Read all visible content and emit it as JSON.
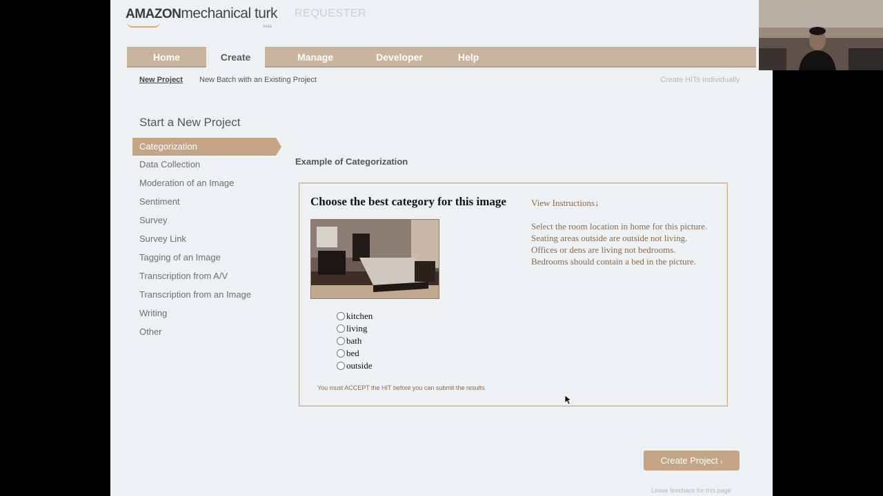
{
  "header": {
    "logo_prefix": "amazon",
    "logo_suffix": "mechanical turk",
    "logo_beta": "beta",
    "section": "REQUESTER"
  },
  "tabs": [
    {
      "label": "Home"
    },
    {
      "label": "Create"
    },
    {
      "label": "Manage"
    },
    {
      "label": "Developer"
    },
    {
      "label": "Help"
    }
  ],
  "active_tab": "Create",
  "subnav": {
    "new_project": "New Project",
    "new_batch": "New Batch with an Existing Project",
    "create_individually": "Create HITs Individually"
  },
  "sidebar": {
    "title": "Start a New Project",
    "selected": "Categorization",
    "items": [
      "Data Collection",
      "Moderation of an Image",
      "Sentiment",
      "Survey",
      "Survey Link",
      "Tagging of an Image",
      "Transcription from A/V",
      "Transcription from an Image",
      "Writing",
      "Other"
    ]
  },
  "example": {
    "label": "Example of Categorization",
    "title": "Choose the best category for this image",
    "view_instructions": "View Instructions",
    "instructions": "Select the room location in home for this picture. Seating areas outside are outside not living. Offices or dens are living not bedrooms. Bedrooms should contain a bed in the picture.",
    "choices": [
      "kitchen",
      "living",
      "bath",
      "bed",
      "outside"
    ],
    "accept_note": "You must ACCEPT the HIT before you can submit the results."
  },
  "actions": {
    "create_project": "Create Project",
    "feedback": "Leave feedback for this page"
  },
  "colors": {
    "accent": "#c6a586",
    "tabbar": "#c9b59e",
    "page_bg": "#eef1f3"
  }
}
